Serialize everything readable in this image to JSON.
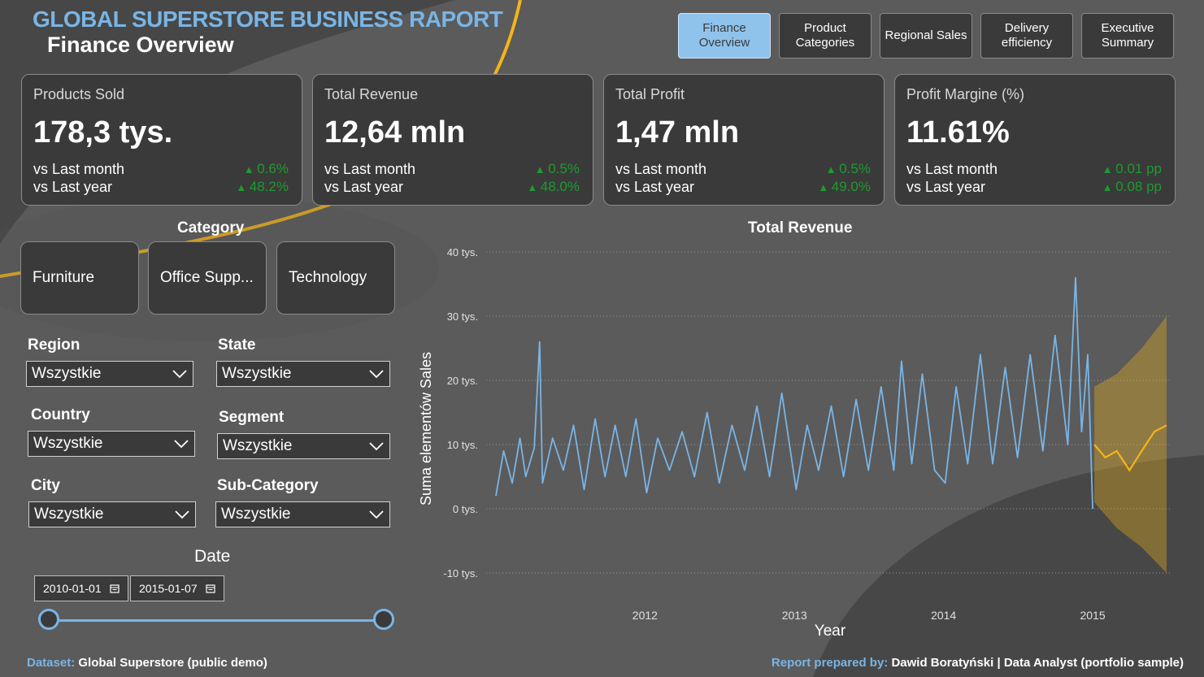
{
  "header": {
    "title": "GLOBAL SUPERSTORE BUSINESS RAPORT",
    "subtitle": "Finance Overview"
  },
  "nav": [
    {
      "label": "Finance\nOverview",
      "active": true
    },
    {
      "label": "Product\nCategories",
      "active": false
    },
    {
      "label": "Regional Sales",
      "active": false
    },
    {
      "label": "Delivery\nefficiency",
      "active": false
    },
    {
      "label": "Executive\nSummary",
      "active": false
    }
  ],
  "kpis": [
    {
      "title": "Products Sold",
      "value": "178,3 tys.",
      "row1_label": "vs Last month",
      "row1_change": "0.6%",
      "row2_label": "vs Last year",
      "row2_change": "48.2%"
    },
    {
      "title": "Total Revenue",
      "value": "12,64 mln",
      "row1_label": "vs Last month",
      "row1_change": "0.5%",
      "row2_label": "vs Last year",
      "row2_change": "48.0%"
    },
    {
      "title": "Total Profit",
      "value": "1,47 mln",
      "row1_label": "vs Last month",
      "row1_change": "0.5%",
      "row2_label": "vs Last year",
      "row2_change": "49.0%"
    },
    {
      "title": "Profit Margine (%)",
      "value": "11.61%",
      "row1_label": "vs Last month",
      "row1_change": "0.01 pp",
      "row2_label": "vs Last year",
      "row2_change": "0.08 pp"
    }
  ],
  "category": {
    "title": "Category",
    "items": [
      "Furniture",
      "Office Supp...",
      "Technology"
    ]
  },
  "filters": {
    "region": {
      "label": "Region",
      "value": "Wszystkie"
    },
    "state": {
      "label": "State",
      "value": "Wszystkie"
    },
    "country": {
      "label": "Country",
      "value": "Wszystkie"
    },
    "segment": {
      "label": "Segment",
      "value": "Wszystkie"
    },
    "city": {
      "label": "City",
      "value": "Wszystkie"
    },
    "subcategory": {
      "label": "Sub-Category",
      "value": "Wszystkie"
    }
  },
  "date": {
    "title": "Date",
    "start": "2010-01-01",
    "end": "2015-01-07"
  },
  "footer": {
    "dataset_label": "Dataset:",
    "dataset_value": "Global Superstore (public demo)",
    "prepared_label": "Report prepared by:",
    "prepared_value": "Dawid Boratyński | Data Analyst (portfolio sample)"
  },
  "colors": {
    "accent_blue": "#79b5e6",
    "forecast_gold": "#f4b41a",
    "positive_green": "#1e9b2e",
    "panel": "#3a3a3a",
    "background": "#5b5b5b"
  },
  "chart_data": {
    "type": "line",
    "title": "Total Revenue",
    "xlabel": "Year",
    "ylabel": "Suma elementów Sales",
    "x_range": [
      "2011-01-01",
      "2015-07-01"
    ],
    "ylim": [
      -10000,
      40000
    ],
    "y_ticks": [
      40000,
      30000,
      20000,
      10000,
      0,
      -10000
    ],
    "y_tick_labels": [
      "40 tys.",
      "30 tys.",
      "20 tys.",
      "10 tys.",
      "0 tys.",
      "-10 tys."
    ],
    "x_ticks": [
      "2012-01-01",
      "2013-01-01",
      "2014-01-01",
      "2015-01-01"
    ],
    "x_tick_labels": [
      "2012",
      "2013",
      "2014",
      "2015"
    ],
    "grid": "horizontal dotted",
    "series": [
      {
        "role": "actual",
        "color": "#79b5e6",
        "points": [
          [
            "2011-01-01",
            2000
          ],
          [
            "2011-01-20",
            9000
          ],
          [
            "2011-02-10",
            4000
          ],
          [
            "2011-03-01",
            11000
          ],
          [
            "2011-03-15",
            5000
          ],
          [
            "2011-04-05",
            9500
          ],
          [
            "2011-04-18",
            26000
          ],
          [
            "2011-04-25",
            4000
          ],
          [
            "2011-05-20",
            11000
          ],
          [
            "2011-06-15",
            6000
          ],
          [
            "2011-07-10",
            13000
          ],
          [
            "2011-08-05",
            3000
          ],
          [
            "2011-09-01",
            14000
          ],
          [
            "2011-09-25",
            5000
          ],
          [
            "2011-10-20",
            13000
          ],
          [
            "2011-11-15",
            5000
          ],
          [
            "2011-12-10",
            14000
          ],
          [
            "2012-01-05",
            2500
          ],
          [
            "2012-02-01",
            11000
          ],
          [
            "2012-03-01",
            6000
          ],
          [
            "2012-04-01",
            12000
          ],
          [
            "2012-05-01",
            5000
          ],
          [
            "2012-06-01",
            15000
          ],
          [
            "2012-07-01",
            4000
          ],
          [
            "2012-08-01",
            13000
          ],
          [
            "2012-09-01",
            6000
          ],
          [
            "2012-10-01",
            16000
          ],
          [
            "2012-11-01",
            5000
          ],
          [
            "2012-12-01",
            18000
          ],
          [
            "2013-01-05",
            3000
          ],
          [
            "2013-02-01",
            13000
          ],
          [
            "2013-03-01",
            6000
          ],
          [
            "2013-04-01",
            16000
          ],
          [
            "2013-05-01",
            5000
          ],
          [
            "2013-06-01",
            17000
          ],
          [
            "2013-07-01",
            6000
          ],
          [
            "2013-08-01",
            19000
          ],
          [
            "2013-09-01",
            6000
          ],
          [
            "2013-09-20",
            23000
          ],
          [
            "2013-10-15",
            7000
          ],
          [
            "2013-11-10",
            21000
          ],
          [
            "2013-12-10",
            6000
          ],
          [
            "2014-01-05",
            4000
          ],
          [
            "2014-02-01",
            19000
          ],
          [
            "2014-03-01",
            7000
          ],
          [
            "2014-04-01",
            24000
          ],
          [
            "2014-05-01",
            7000
          ],
          [
            "2014-06-01",
            22000
          ],
          [
            "2014-07-01",
            8000
          ],
          [
            "2014-08-01",
            24000
          ],
          [
            "2014-09-01",
            9000
          ],
          [
            "2014-10-01",
            27000
          ],
          [
            "2014-11-01",
            10000
          ],
          [
            "2014-11-20",
            36000
          ],
          [
            "2014-12-05",
            12000
          ],
          [
            "2014-12-20",
            24000
          ],
          [
            "2015-01-01",
            0
          ]
        ]
      },
      {
        "role": "forecast",
        "color": "#f4b41a",
        "points": [
          [
            "2015-01-05",
            10000
          ],
          [
            "2015-02-01",
            8000
          ],
          [
            "2015-03-01",
            9000
          ],
          [
            "2015-04-01",
            6000
          ],
          [
            "2015-05-01",
            9000
          ],
          [
            "2015-06-01",
            12000
          ],
          [
            "2015-07-01",
            13000
          ]
        ],
        "upper": [
          [
            "2015-01-05",
            19000
          ],
          [
            "2015-03-01",
            21000
          ],
          [
            "2015-05-01",
            25000
          ],
          [
            "2015-07-01",
            30000
          ]
        ],
        "lower": [
          [
            "2015-01-05",
            1000
          ],
          [
            "2015-03-01",
            -3000
          ],
          [
            "2015-05-01",
            -6000
          ],
          [
            "2015-07-01",
            -10000
          ]
        ]
      }
    ]
  }
}
